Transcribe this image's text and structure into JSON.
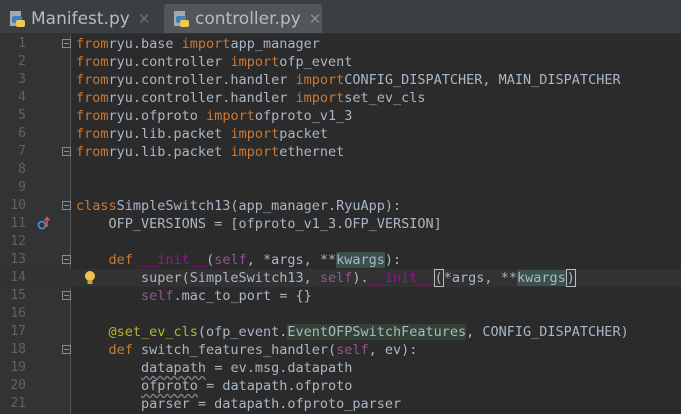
{
  "tabs": [
    {
      "label": "Manifest.py",
      "active": false
    },
    {
      "label": "controller.py",
      "active": true
    }
  ],
  "colors": {
    "keyword": "#cc7832",
    "self": "#94558d",
    "decorator": "#bbb529",
    "background": "#2b2b2b"
  },
  "lines": [
    {
      "n": "1",
      "tokens": [
        [
          "kw",
          "from"
        ],
        [
          "",
          "ryu.base "
        ],
        [
          "kw",
          "import"
        ],
        [
          "",
          "app_manager"
        ]
      ]
    },
    {
      "n": "2",
      "tokens": [
        [
          "kw",
          "from"
        ],
        [
          "",
          "ryu.controller "
        ],
        [
          "kw",
          "import"
        ],
        [
          "",
          "ofp_event"
        ]
      ]
    },
    {
      "n": "3",
      "tokens": [
        [
          "kw",
          "from"
        ],
        [
          "",
          "ryu.controller.handler "
        ],
        [
          "kw",
          "import"
        ],
        [
          "",
          "CONFIG_DISPATCHER, MAIN_DISPATCHER"
        ]
      ]
    },
    {
      "n": "4",
      "tokens": [
        [
          "kw",
          "from"
        ],
        [
          "",
          "ryu.controller.handler "
        ],
        [
          "kw",
          "import"
        ],
        [
          "",
          "set_ev_cls"
        ]
      ]
    },
    {
      "n": "5",
      "tokens": [
        [
          "kw",
          "from"
        ],
        [
          "",
          "ryu.ofproto "
        ],
        [
          "kw",
          "import"
        ],
        [
          "",
          "ofproto_v1_3"
        ]
      ]
    },
    {
      "n": "6",
      "tokens": [
        [
          "kw",
          "from"
        ],
        [
          "",
          "ryu.lib.packet "
        ],
        [
          "kw",
          "import"
        ],
        [
          "",
          "packet"
        ]
      ]
    },
    {
      "n": "7",
      "tokens": [
        [
          "kw",
          "from"
        ],
        [
          "",
          "ryu.lib.packet "
        ],
        [
          "kw",
          "import"
        ],
        [
          "",
          "ethernet"
        ]
      ]
    },
    {
      "n": "8",
      "tokens": []
    },
    {
      "n": "9",
      "tokens": []
    },
    {
      "n": "10",
      "tokens": [
        [
          "kw",
          "class"
        ],
        [
          "",
          "SimpleSwitch13(app_manager.RyuApp):"
        ]
      ]
    },
    {
      "n": "11",
      "tokens": [
        [
          "",
          "    OFP_VERSIONS = [ofproto_v1_3.OFP_VERSION]"
        ]
      ]
    },
    {
      "n": "12",
      "tokens": []
    },
    {
      "n": "13",
      "tokens": [
        [
          "kw",
          "    def "
        ],
        [
          "magic",
          "__init__"
        ],
        [
          "",
          "("
        ],
        [
          "slf",
          "self"
        ],
        [
          "",
          ", *args, **"
        ],
        [
          "ref",
          "kwargs"
        ],
        [
          "",
          "):"
        ]
      ]
    },
    {
      "n": "14",
      "tokens": [
        [
          "",
          "        super(SimpleSwitch13, "
        ],
        [
          "slf",
          "self"
        ],
        [
          "",
          ")."
        ],
        [
          "magic",
          "__init__"
        ],
        [
          "match",
          "("
        ],
        [
          "",
          "*args, **"
        ],
        [
          "ref",
          "kwargs"
        ],
        [
          "match",
          ")"
        ]
      ]
    },
    {
      "n": "15",
      "tokens": [
        [
          "slf",
          "        self"
        ],
        [
          "",
          ".mac_to_port = {}"
        ]
      ]
    },
    {
      "n": "16",
      "tokens": []
    },
    {
      "n": "17",
      "tokens": [
        [
          "dec",
          "    @set_ev_cls"
        ],
        [
          "",
          "(ofp_event."
        ],
        [
          "hl",
          "EventOFPSwitchFeatures"
        ],
        [
          "",
          ", CONFIG_DISPATCHER)"
        ]
      ]
    },
    {
      "n": "18",
      "tokens": [
        [
          "kw",
          "    def "
        ],
        [
          "",
          "switch_features_handler("
        ],
        [
          "slf",
          "self"
        ],
        [
          "",
          ", ev):"
        ]
      ]
    },
    {
      "n": "19",
      "tokens": [
        [
          "",
          "        "
        ],
        [
          "squig",
          "datapath"
        ],
        [
          "",
          " = ev.msg.datapath"
        ]
      ]
    },
    {
      "n": "20",
      "tokens": [
        [
          "",
          "        "
        ],
        [
          "squig",
          "ofproto"
        ],
        [
          "",
          " = datapath.ofproto"
        ]
      ]
    },
    {
      "n": "21",
      "tokens": [
        [
          "",
          "        parser = datapath.ofproto_parser"
        ]
      ]
    }
  ]
}
